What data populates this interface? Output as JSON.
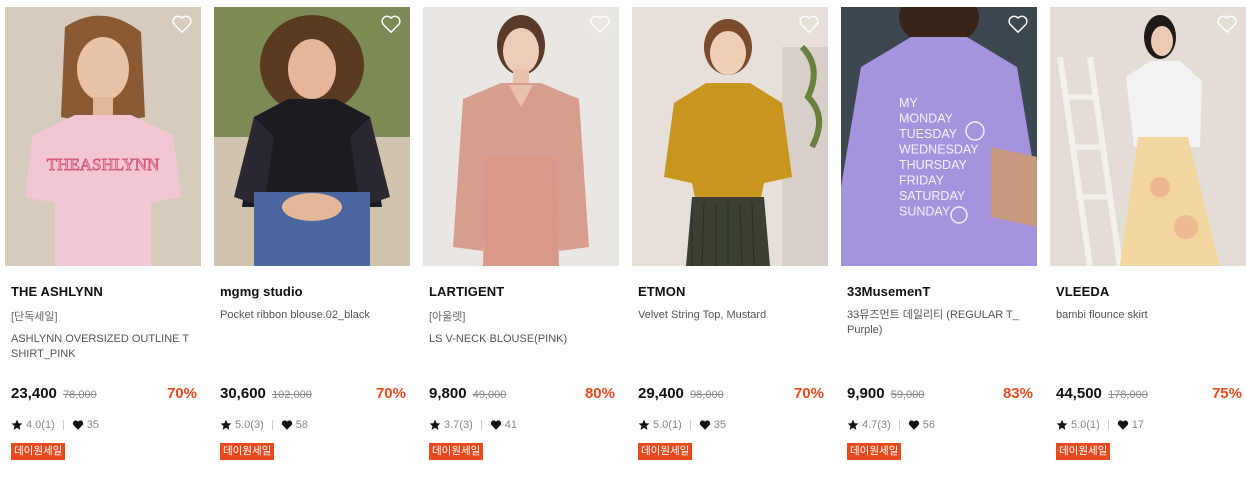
{
  "products": [
    {
      "brand": "THE ASHLYNN",
      "tag": "[단독세일]",
      "name": "ASHLYNN OVERSIZED OUTLINE T SHIRT_PINK",
      "price": "23,400",
      "original_price": "78,000",
      "discount": "70%",
      "rating": "4.0(1)",
      "likes": "35",
      "badge": "데이원세일",
      "bg_color": "#d9cfc2",
      "garment_color": "#f2c7d3",
      "garment_print": "THEASHLYNN"
    },
    {
      "brand": "mgmg studio",
      "tag": "",
      "name": "Pocket ribbon blouse.02_black",
      "price": "30,600",
      "original_price": "102,000",
      "discount": "70%",
      "rating": "5.0(3)",
      "likes": "58",
      "badge": "데이원세일",
      "bg_color": "#6f7f4a",
      "garment_color": "#1d1b22"
    },
    {
      "brand": "LARTIGENT",
      "tag": "[아울렛]",
      "name": "LS V-NECK BLOUSE(PINK)",
      "price": "9,800",
      "original_price": "49,000",
      "discount": "80%",
      "rating": "3.7(3)",
      "likes": "41",
      "badge": "데이원세일",
      "bg_color": "#ebe7e4",
      "garment_color": "#d79d8f"
    },
    {
      "brand": "ETMON",
      "tag": "",
      "name": "Velvet String Top, Mustard",
      "price": "29,400",
      "original_price": "98,000",
      "discount": "70%",
      "rating": "5.0(1)",
      "likes": "35",
      "badge": "데이원세일",
      "bg_color": "#e7e2dc",
      "garment_color": "#c8951f"
    },
    {
      "brand": "33MusemenT",
      "tag": "",
      "name": "33뮤즈먼트 데일리티 (REGULAR T_ Purple)",
      "price": "9,900",
      "original_price": "59,000",
      "discount": "83%",
      "rating": "4.7(3)",
      "likes": "56",
      "badge": "데이원세일",
      "bg_color": "#3f4a52",
      "garment_color": "#a693dd",
      "garment_print": [
        "MY",
        "MONDAY",
        "TUESDAY",
        "WEDNESDAY",
        "THURSDAY",
        "FRIDAY",
        "SATURDAY",
        "SUNDAY"
      ]
    },
    {
      "brand": "VLEEDA",
      "tag": "",
      "name": "bambi flounce skirt",
      "price": "44,500",
      "original_price": "178,000",
      "discount": "75%",
      "rating": "5.0(1)",
      "likes": "17",
      "badge": "데이원세일",
      "bg_color": "#e6e1db",
      "garment_color": "#f2d59f"
    }
  ],
  "colors": {
    "accent": "#e8491d",
    "text": "#111111",
    "muted": "#888888"
  },
  "icons": {
    "wishlist": "heart-outline-icon",
    "rating": "star-icon",
    "likes": "heart-filled-icon"
  }
}
